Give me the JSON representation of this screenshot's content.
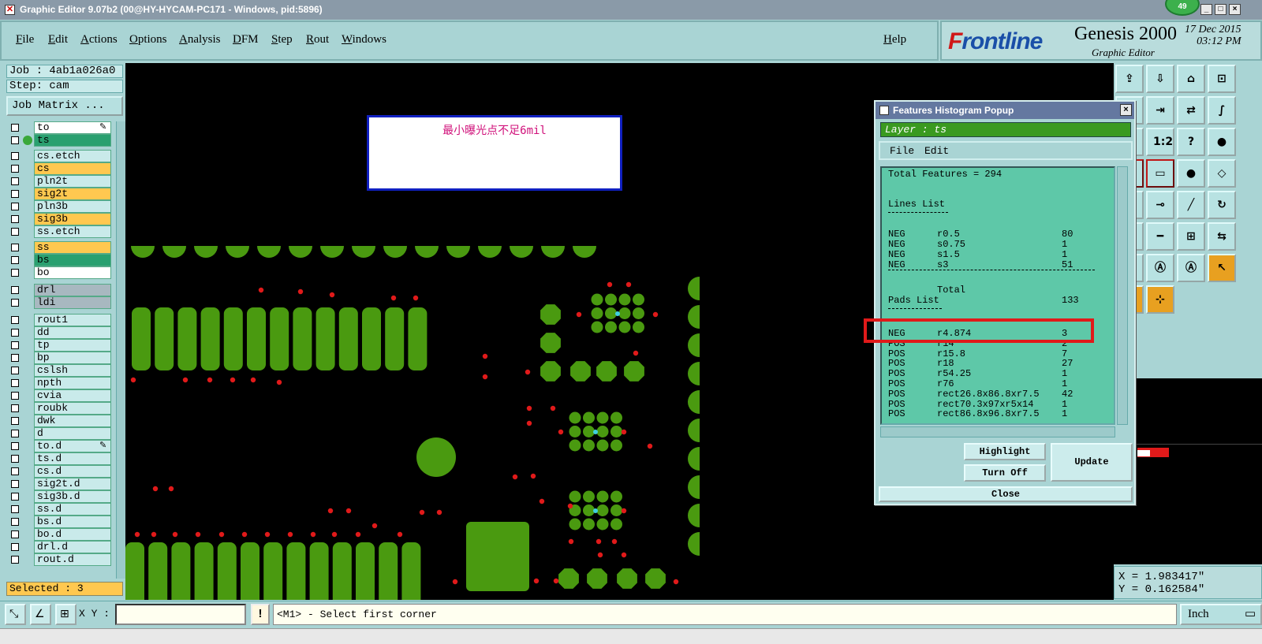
{
  "window": {
    "title": "Graphic Editor 9.07b2 (00@HY-HYCAM-PC171 - Windows, pid:5896)",
    "badge": "49",
    "min_glyph": "_",
    "max_glyph": "□",
    "close_glyph": "×"
  },
  "menu": {
    "items": [
      "File",
      "Edit",
      "Actions",
      "Options",
      "Analysis",
      "DFM",
      "Step",
      "Rout",
      "Windows"
    ],
    "help": "Help"
  },
  "brand": {
    "logo_prefix": "F",
    "logo_rest": "rontline",
    "product": "Genesis 2000",
    "subtitle": "Graphic Editor",
    "date": "17 Dec 2015",
    "time": "03:12 PM"
  },
  "left": {
    "job": "Job : 4ab1a026a0",
    "step": "Step: cam",
    "matrix_button": "Job Matrix ...",
    "layers": [
      {
        "name": "to",
        "color": "#ffffff",
        "mark": "✎"
      },
      {
        "name": "ts",
        "color": "#2aa070",
        "mark": "",
        "active": true
      },
      {
        "name": "cs.etch",
        "color": "#c9eaea",
        "mark": ""
      },
      {
        "name": "cs",
        "color": "#ffc850",
        "mark": ""
      },
      {
        "name": "pln2t",
        "color": "#c9eaea",
        "mark": ""
      },
      {
        "name": "sig2t",
        "color": "#ffc850",
        "mark": ""
      },
      {
        "name": "pln3b",
        "color": "#c9eaea",
        "mark": ""
      },
      {
        "name": "sig3b",
        "color": "#ffc850",
        "mark": ""
      },
      {
        "name": "ss.etch",
        "color": "#c9eaea",
        "mark": ""
      },
      {
        "name": "ss",
        "color": "#ffc850",
        "mark": ""
      },
      {
        "name": "bs",
        "color": "#2aa070",
        "mark": ""
      },
      {
        "name": "bo",
        "color": "#ffffff",
        "mark": ""
      },
      {
        "name": "drl",
        "color": "#a8b8c0",
        "mark": ""
      },
      {
        "name": "ldi",
        "color": "#a8b8c0",
        "mark": ""
      },
      {
        "name": "rout1",
        "color": "#c9eaea",
        "mark": ""
      },
      {
        "name": "dd",
        "color": "#c9eaea",
        "mark": ""
      },
      {
        "name": "tp",
        "color": "#c9eaea",
        "mark": ""
      },
      {
        "name": "bp",
        "color": "#c9eaea",
        "mark": ""
      },
      {
        "name": "cslsh",
        "color": "#c9eaea",
        "mark": ""
      },
      {
        "name": "npth",
        "color": "#c9eaea",
        "mark": ""
      },
      {
        "name": "cvia",
        "color": "#c9eaea",
        "mark": ""
      },
      {
        "name": "roubk",
        "color": "#c9eaea",
        "mark": ""
      },
      {
        "name": "dwk",
        "color": "#c9eaea",
        "mark": ""
      },
      {
        "name": "d",
        "color": "#c9eaea",
        "mark": ""
      },
      {
        "name": "to.d",
        "color": "#c9eaea",
        "mark": "✎"
      },
      {
        "name": "ts.d",
        "color": "#c9eaea",
        "mark": ""
      },
      {
        "name": "cs.d",
        "color": "#c9eaea",
        "mark": ""
      },
      {
        "name": "sig2t.d",
        "color": "#c9eaea",
        "mark": ""
      },
      {
        "name": "sig3b.d",
        "color": "#c9eaea",
        "mark": ""
      },
      {
        "name": "ss.d",
        "color": "#c9eaea",
        "mark": ""
      },
      {
        "name": "bs.d",
        "color": "#c9eaea",
        "mark": ""
      },
      {
        "name": "bo.d",
        "color": "#c9eaea",
        "mark": ""
      },
      {
        "name": "drl.d",
        "color": "#c9eaea",
        "mark": ""
      },
      {
        "name": "rout.d",
        "color": "#c9eaea",
        "mark": ""
      }
    ],
    "selected": "Selected : 3"
  },
  "canvas": {
    "annotation": "最小曝光点不足6mil",
    "pad_color": "#4a9a10",
    "drill_color": "#e01a1a",
    "via_color": "#40d0e0"
  },
  "popup": {
    "title": "Features Histogram Popup",
    "close_glyph": "×",
    "layer": "Layer :  ts",
    "menu": [
      "File",
      "Edit"
    ],
    "total": "Total Features = 294",
    "lines_header": "Lines List",
    "lines": [
      {
        "pol": "NEG",
        "sym": "r0.5",
        "count": "80"
      },
      {
        "pol": "NEG",
        "sym": "s0.75",
        "count": "1"
      },
      {
        "pol": "NEG",
        "sym": "s1.5",
        "count": "1"
      },
      {
        "pol": "NEG",
        "sym": "s3",
        "count": "51"
      }
    ],
    "lines_total_label": "Total",
    "lines_total": "133",
    "pads_header": "Pads List",
    "pads": [
      {
        "pol": "NEG",
        "sym": "r4.874",
        "count": "3"
      },
      {
        "pol": "POS",
        "sym": "r14",
        "count": "2"
      },
      {
        "pol": "POS",
        "sym": "r15.8",
        "count": "7"
      },
      {
        "pol": "POS",
        "sym": "r18",
        "count": "27"
      },
      {
        "pol": "POS",
        "sym": "r54.25",
        "count": "1"
      },
      {
        "pol": "POS",
        "sym": "r76",
        "count": "1"
      },
      {
        "pol": "POS",
        "sym": "rect26.8x86.8xr7.5",
        "count": "42"
      },
      {
        "pol": "POS",
        "sym": "rect70.3x97xr5x14",
        "count": "1"
      },
      {
        "pol": "POS",
        "sym": "rect86.8x96.8xr7.5",
        "count": "1"
      }
    ],
    "highlight_button": "Highlight",
    "turnoff_button": "Turn Off",
    "update_button": "Update",
    "close_button": "Close"
  },
  "toolbar": {
    "icons": [
      "import-icon",
      "export-icon",
      "home-icon",
      "zoom-box-icon",
      "text-box-icon",
      "move-icon",
      "swap-icon",
      "s-curve-icon",
      "pan-icon",
      "scale-icon",
      "question-icon",
      "pad-icon",
      "snap-icon",
      "measure-icon",
      "circle-icon",
      "polygon-icon",
      "cross-icon",
      "connect-icon",
      "line-icon",
      "arc-icon",
      "slash-icon",
      "dash-icon",
      "center-icon",
      "transfer-icon",
      "arch-icon",
      "arch2-icon",
      "arch3-icon",
      "select-icon",
      "select-arrow-icon",
      "select-area-icon"
    ],
    "glyphs": [
      "⇪",
      "⇩",
      "⌂",
      "⊡",
      "▭",
      "⇥",
      "⇄",
      "∫",
      "✥",
      "1:2",
      "?",
      "●",
      "⊙",
      "▭",
      "●",
      "◇",
      "✕",
      "⊸",
      "╱",
      "↻",
      "╱",
      "━",
      "⊞",
      "⇆",
      "Ⓐ",
      "Ⓐ",
      "Ⓐ",
      "↖",
      "↖",
      "⊹"
    ]
  },
  "coords": {
    "x": "X = 1.983417\"",
    "y": "Y = 0.162584\""
  },
  "status": {
    "xy_label": "X Y :",
    "xy_value": "",
    "warn_glyph": "!",
    "prompt": "<M1> - Select first corner",
    "unit": "Inch",
    "unit_glyph": "▭"
  }
}
